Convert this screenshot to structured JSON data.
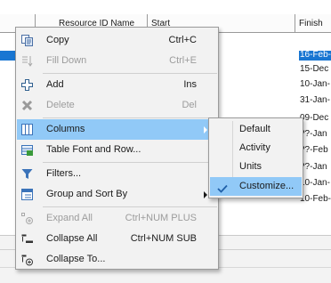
{
  "table": {
    "header": {
      "resource_id_name": "Resource ID Name",
      "start": "Start",
      "finish": "Finish"
    },
    "finish_values": [
      "16-Feb-",
      "15-Dec",
      "10-Jan-",
      "31-Jan-",
      "09-Dec",
      "??-Jan",
      "??-Feb",
      "??-Jan",
      "10-Jan-",
      "10-Feb-"
    ],
    "selected_row_index": 0,
    "colors": {
      "selection": "#1976d2",
      "menu_highlight": "#91c9f7"
    }
  },
  "context_menu": {
    "items": [
      {
        "label": "Copy",
        "shortcut": "Ctrl+C",
        "icon": "copy-icon",
        "enabled": true
      },
      {
        "label": "Fill Down",
        "shortcut": "Ctrl+E",
        "icon": "fill-down-icon",
        "enabled": false
      },
      {
        "label": "Add",
        "shortcut": "Ins",
        "icon": "add-icon",
        "enabled": true
      },
      {
        "label": "Delete",
        "shortcut": "Del",
        "icon": "delete-icon",
        "enabled": false
      },
      {
        "label": "Columns",
        "shortcut": "",
        "icon": "columns-icon",
        "enabled": true,
        "highlighted": true,
        "submenu": true
      },
      {
        "label": "Table Font and Row...",
        "shortcut": "",
        "icon": "table-font-icon",
        "enabled": true
      },
      {
        "label": "Filters...",
        "shortcut": "",
        "icon": "filter-icon",
        "enabled": true
      },
      {
        "label": "Group and Sort By",
        "shortcut": "",
        "icon": "group-sort-icon",
        "enabled": true,
        "submenu": true
      },
      {
        "label": "Expand All",
        "shortcut": "Ctrl+NUM PLUS",
        "icon": "expand-all-icon",
        "enabled": false
      },
      {
        "label": "Collapse All",
        "shortcut": "Ctrl+NUM SUB",
        "icon": "collapse-all-icon",
        "enabled": true
      },
      {
        "label": "Collapse To...",
        "shortcut": "",
        "icon": "collapse-to-icon",
        "enabled": true
      }
    ]
  },
  "columns_submenu": {
    "items": [
      {
        "label": "Default",
        "checked": false
      },
      {
        "label": "Activity",
        "checked": false
      },
      {
        "label": "Units",
        "checked": false
      },
      {
        "label": "Customize...",
        "checked": true,
        "highlighted": true
      }
    ]
  }
}
